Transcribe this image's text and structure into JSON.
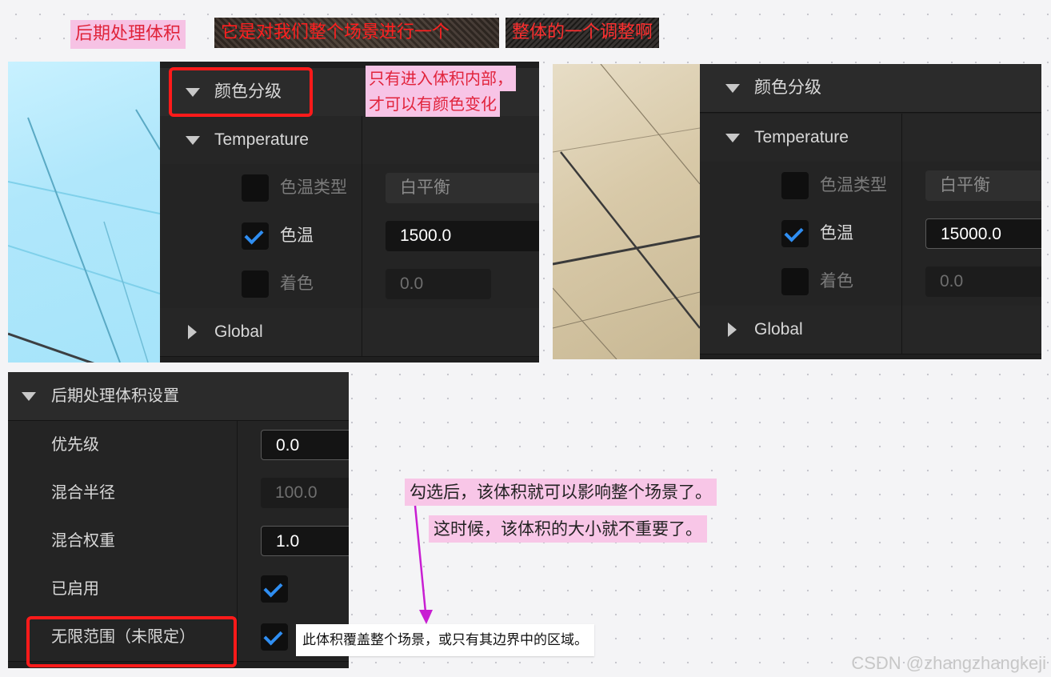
{
  "top_notes": {
    "title": "后期处理体积",
    "desc_1": "它是对我们整个场景进行一个",
    "desc_2": "整体的一个调整啊"
  },
  "panel_left": {
    "section": "颜色分级",
    "group_temperature": "Temperature",
    "row_temp_type_label": "色温类型",
    "row_temp_type_value": "白平衡",
    "row_temp_label": "色温",
    "row_temp_value": "1500.0",
    "row_tint_label": "着色",
    "row_tint_value": "0.0",
    "group_global": "Global",
    "callout_line1": "只有进入体积内部，",
    "callout_line2": "才可以有颜色变化"
  },
  "panel_right": {
    "section": "颜色分级",
    "group_temperature": "Temperature",
    "row_temp_type_label": "色温类型",
    "row_temp_type_value": "白平衡",
    "row_temp_label": "色温",
    "row_temp_value": "15000.0",
    "row_tint_label": "着色",
    "row_tint_value": "0.0",
    "group_global": "Global"
  },
  "panel_settings": {
    "section": "后期处理体积设置",
    "priority_label": "优先级",
    "priority_value": "0.0",
    "blend_radius_label": "混合半径",
    "blend_radius_value": "100.0",
    "blend_weight_label": "混合权重",
    "blend_weight_value": "1.0",
    "enabled_label": "已启用",
    "unbound_label": "无限范围（未限定）",
    "unbound_tooltip": "此体积覆盖整个场景，或只有其边界中的区域。"
  },
  "annotation": {
    "line1": "勾选后，该体积就可以影响整个场景了。",
    "line2": "这时候，该体积的大小就不重要了。"
  },
  "colors": {
    "panel_bg": "#1f1f1f",
    "check_blue": "#2f8ef2",
    "callout_red": "#ff1a1a",
    "arrow_magenta": "#c81ed2"
  },
  "watermark": "CSDN @zhangzhangkeji"
}
